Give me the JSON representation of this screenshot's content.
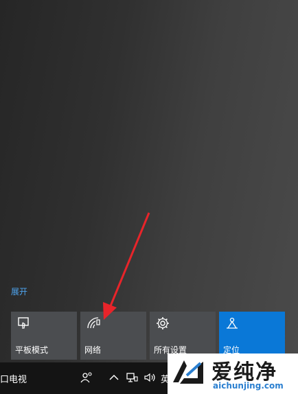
{
  "action_center": {
    "expand_label": "展开",
    "quick_actions": [
      {
        "label": "平板模式",
        "icon": "tablet-mode-icon",
        "active": false
      },
      {
        "label": "网络",
        "icon": "network-icon",
        "active": false
      },
      {
        "label": "所有设置",
        "icon": "gear-icon",
        "active": false
      },
      {
        "label": "定位",
        "icon": "location-icon",
        "active": true
      }
    ]
  },
  "taskbar": {
    "partial_text": "口电视",
    "tray_icons": [
      "people-icon",
      "chevron-up-icon",
      "network-status-icon",
      "volume-icon"
    ],
    "ime_partial": "英"
  },
  "watermark": {
    "brand": "爱纯净",
    "url": "aichunjing.com"
  },
  "colors": {
    "accent": "#0a78d7",
    "link": "#4ea5f0",
    "tile": "#4b4d50",
    "taskbar": "#141414",
    "annotation_arrow": "#e8242a"
  }
}
